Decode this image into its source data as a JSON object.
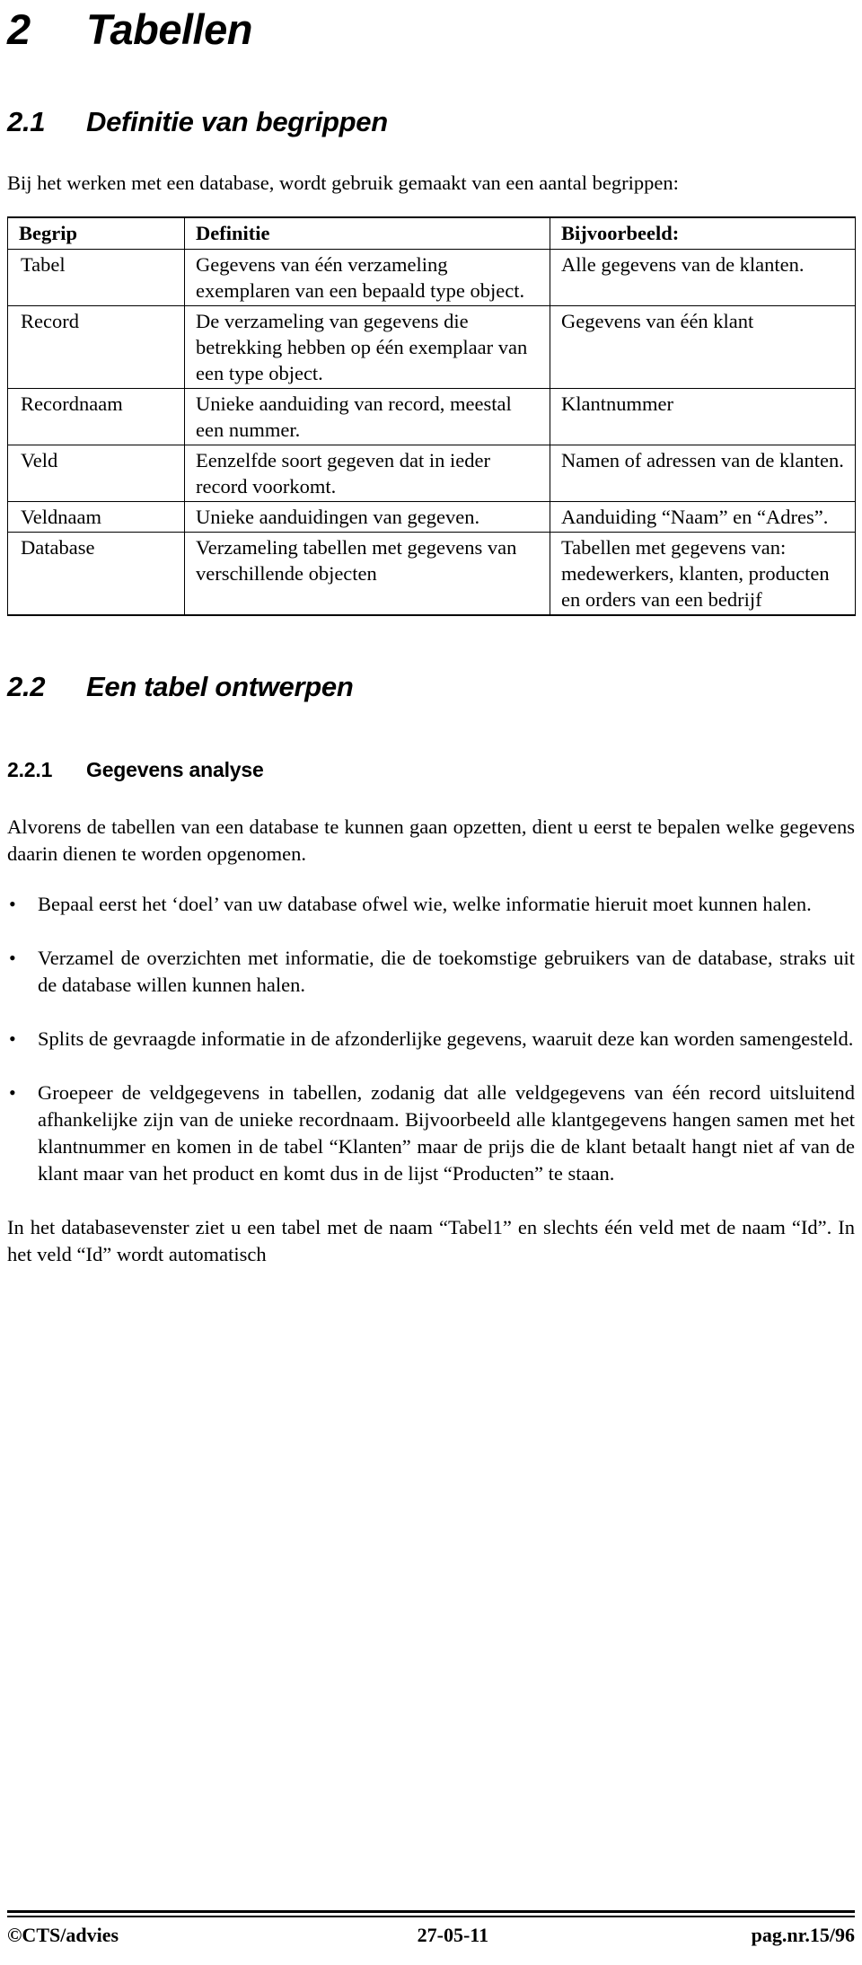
{
  "headings": {
    "h1": {
      "number": "2",
      "text": "Tabellen"
    },
    "h2_1": {
      "number": "2.1",
      "text": "Definitie van begrippen"
    },
    "h2_2": {
      "number": "2.2",
      "text": "Een tabel ontwerpen"
    },
    "h3_1": {
      "number": "2.2.1",
      "text": "Gegevens analyse"
    }
  },
  "intro_paragraph": "Bij het werken met een database, wordt gebruik gemaakt van een aantal begrippen:",
  "table": {
    "headers": [
      "Begrip",
      "Definitie",
      "Bijvoorbeeld:"
    ],
    "rows": [
      {
        "begrip": "Tabel",
        "definitie": "Gegevens van één verzameling exemplaren van een bepaald type object.",
        "bijvoorbeeld": "Alle gegevens van de klanten."
      },
      {
        "begrip": "Record",
        "definitie": "De verzameling van gegevens die betrekking hebben op één exemplaar van een type object.",
        "bijvoorbeeld": "Gegevens van één klant"
      },
      {
        "begrip": "Recordnaam",
        "definitie": "Unieke aanduiding van record, meestal een nummer.",
        "bijvoorbeeld": "Klantnummer"
      },
      {
        "begrip": "Veld",
        "definitie": "Eenzelfde soort gegeven dat in ieder record voorkomt.",
        "bijvoorbeeld": "Namen of adressen van de klanten."
      },
      {
        "begrip": "Veldnaam",
        "definitie": "Unieke aanduidingen van gegeven.",
        "bijvoorbeeld": "Aanduiding “Naam” en “Adres”."
      },
      {
        "begrip": "Database",
        "definitie": "Verzameling tabellen met gegevens van verschillende objecten",
        "bijvoorbeeld": "Tabellen met gegevens van: medewerkers, klanten, producten en orders van een bedrijf"
      }
    ]
  },
  "analysis_paragraph": "Alvorens de tabellen van een database te kunnen gaan opzetten, dient u  eerst te bepalen welke gegevens daarin dienen te worden opgenomen.",
  "bullets": [
    {
      "marker": "•",
      "text": "Bepaal eerst het ‘doel’ van uw database ofwel wie, welke informatie hieruit moet kunnen halen."
    },
    {
      "marker": "•",
      "text": "Verzamel de overzichten met informatie, die de toekomstige gebruikers van de database, straks uit de database willen kunnen halen."
    },
    {
      "marker": "•",
      "text": "Splits de gevraagde informatie in de afzonderlijke gegevens, waaruit deze kan worden samengesteld."
    },
    {
      "marker": "•",
      "text": "Groepeer de veldgegevens in tabellen, zodanig dat alle veldgegevens van één record uitsluitend afhankelijke zijn van de unieke recordnaam. Bijvoorbeeld alle klantgegevens hangen samen met het klantnummer en komen in de tabel “Klanten” maar de prijs die de klant betaalt hangt niet af van de klant maar van het product en komt dus in de lijst “Producten” te staan."
    }
  ],
  "closing_paragraph": "In het databasevenster ziet u een tabel met de naam “Tabel1” en slechts één veld met de naam “Id”. In het veld “Id” wordt automatisch",
  "footer": {
    "left": "©CTS/advies",
    "center": "27-05-11",
    "right": "pag.nr.15/96"
  }
}
